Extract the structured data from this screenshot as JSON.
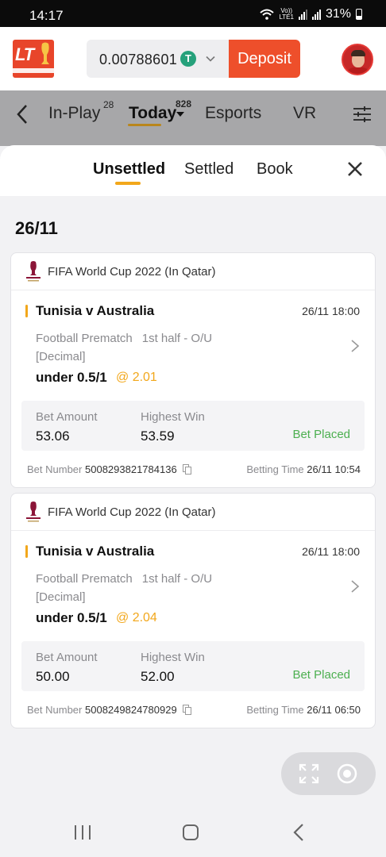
{
  "status_bar": {
    "time": "14:17",
    "network": "VoLTE1",
    "battery": "31%"
  },
  "header": {
    "logo_text": "LT",
    "balance": "0.00788601",
    "currency_icon": "tether-icon",
    "coin_symbol": "T",
    "deposit_label": "Deposit"
  },
  "sports_nav": {
    "tabs": [
      {
        "label": "In-Play",
        "badge": "28"
      },
      {
        "label": "Today",
        "badge": "828",
        "active": true
      },
      {
        "label": "Esports",
        "badge": ""
      },
      {
        "label": "VR",
        "badge": ""
      }
    ]
  },
  "sheet": {
    "tabs": [
      {
        "label": "Unsettled",
        "active": true
      },
      {
        "label": "Settled"
      },
      {
        "label": "Book"
      }
    ],
    "date": "26/11",
    "bets": [
      {
        "league": "FIFA World Cup 2022 (In Qatar)",
        "match": "Tunisia v Australia",
        "match_time": "26/11 18:00",
        "market_line1": "Football Prematch",
        "market_type": "1st half - O/U",
        "odds_format": "[Decimal]",
        "selection": "under 0.5/1",
        "odds": "@ 2.01",
        "bet_amount_label": "Bet Amount",
        "bet_amount": "53.06",
        "highest_win_label": "Highest Win",
        "highest_win": "53.59",
        "status": "Bet Placed",
        "bet_number_label": "Bet Number",
        "bet_number": "5008293821784136",
        "betting_time_label": "Betting Time",
        "betting_time": "26/11 10:54"
      },
      {
        "league": "FIFA World Cup 2022 (In Qatar)",
        "match": "Tunisia v Australia",
        "match_time": "26/11 18:00",
        "market_line1": "Football Prematch",
        "market_type": "1st half - O/U",
        "odds_format": "[Decimal]",
        "selection": "under 0.5/1",
        "odds": "@ 2.04",
        "bet_amount_label": "Bet Amount",
        "bet_amount": "50.00",
        "highest_win_label": "Highest Win",
        "highest_win": "52.00",
        "status": "Bet Placed",
        "bet_number_label": "Bet Number",
        "bet_number": "5008249824780929",
        "betting_time_label": "Betting Time",
        "betting_time": "26/11 06:50"
      }
    ]
  },
  "colors": {
    "brand": "#ee4f2b",
    "accent": "#f2a71b",
    "status_green": "#4caf50"
  }
}
